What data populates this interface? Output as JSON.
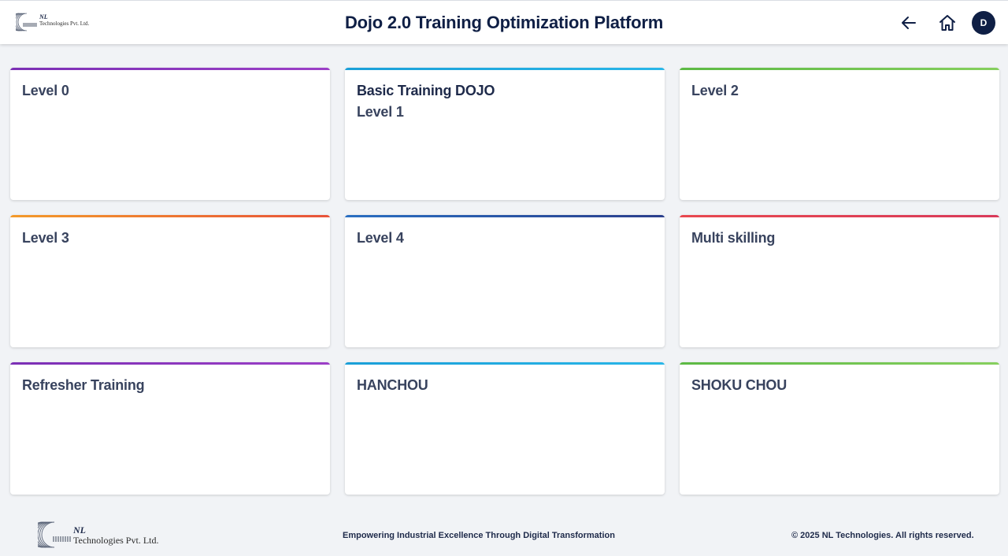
{
  "header": {
    "logo": {
      "mark": "NL",
      "company": "Technologies Pvt. Ltd."
    },
    "title": "Dojo 2.0 Training Optimization Platform",
    "back_icon": "arrow-left-icon",
    "home_icon": "home-icon",
    "avatar_initial": "D"
  },
  "cards": [
    {
      "title": "Level 0",
      "subtitle": "",
      "accent": [
        "#7b2fb5",
        "#9c3fc7"
      ]
    },
    {
      "title": "Basic Training DOJO",
      "subtitle": "Level 1",
      "accent": [
        "#1a9fd8",
        "#29b6e8"
      ]
    },
    {
      "title": "Level 2",
      "subtitle": "",
      "accent": [
        "#5cb944",
        "#86cf5e"
      ]
    },
    {
      "title": "Level 3",
      "subtitle": "",
      "accent": [
        "#f39a2a",
        "#e8533a"
      ]
    },
    {
      "title": "Level 4",
      "subtitle": "",
      "accent": [
        "#2a6fc2",
        "#2b3f8c"
      ]
    },
    {
      "title": "Multi skilling",
      "subtitle": "",
      "accent": [
        "#e8484f",
        "#d93a5a"
      ]
    },
    {
      "title": "Refresher Training",
      "subtitle": "",
      "accent": [
        "#7b2fb5",
        "#9c3fc7"
      ]
    },
    {
      "title": "HANCHOU",
      "subtitle": "",
      "accent": [
        "#1a9fd8",
        "#29b6e8"
      ]
    },
    {
      "title": "SHOKU CHOU",
      "subtitle": "",
      "accent": [
        "#5cb944",
        "#86cf5e"
      ]
    }
  ],
  "footer": {
    "logo": {
      "mark": "NL",
      "company": "Technologies Pvt. Ltd."
    },
    "tagline": "Empowering Industrial Excellence Through Digital Transformation",
    "copyright": "© 2025 NL Technologies. All rights reserved."
  }
}
